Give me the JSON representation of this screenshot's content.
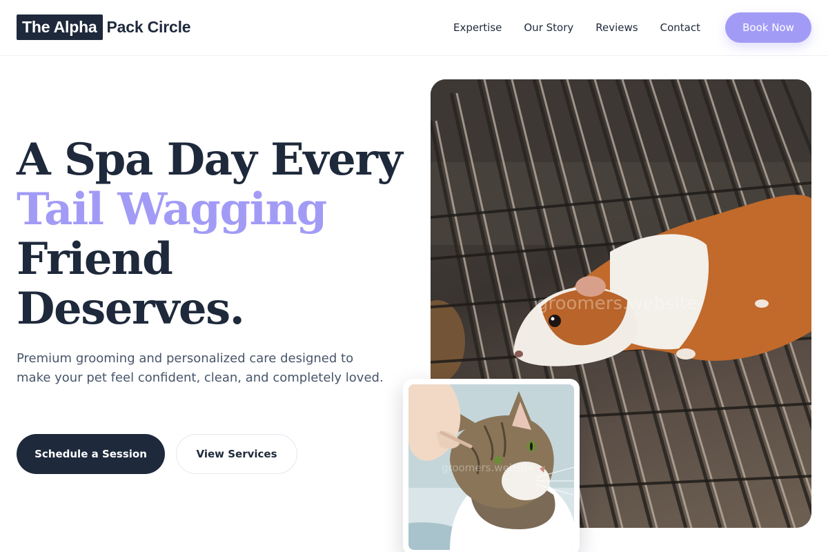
{
  "brand": {
    "highlight": "The Alpha",
    "rest": "Pack Circle"
  },
  "nav": {
    "items": [
      "Expertise",
      "Our Story",
      "Reviews",
      "Contact"
    ],
    "cta": "Book Now"
  },
  "hero": {
    "title_line1": "A Spa Day Every",
    "title_accent": "Tail Wagging",
    "title_line3": "Friend",
    "title_line4": "Deserves.",
    "subtitle": "Premium grooming and personalized care designed to make your pet feel confident, clean, and completely loved.",
    "primary_button": "Schedule a Session",
    "secondary_button": "View Services"
  },
  "images": {
    "main_watermark": "groomers.website",
    "card_watermark": "groomers.website"
  },
  "colors": {
    "navy": "#1e293b",
    "accent": "#a29bf6",
    "muted_text": "#475569"
  }
}
